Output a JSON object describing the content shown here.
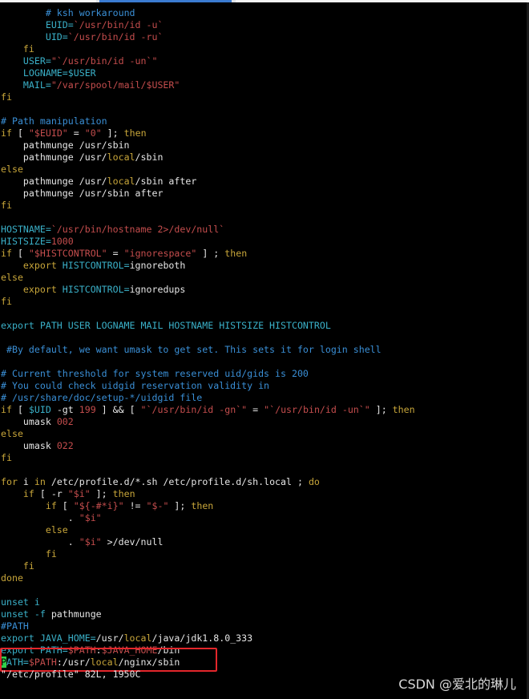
{
  "status_line": "\"/etc/profile\" 82L, 1950C",
  "watermark": "CSDN @爱北的琳儿",
  "lines": [
    [
      {
        "t": "        ",
        "c": "t"
      },
      {
        "t": "# ksh workaround",
        "c": "c"
      }
    ],
    [
      {
        "t": "        ",
        "c": "t"
      },
      {
        "t": "EUID=",
        "c": "v"
      },
      {
        "t": "`/usr/bin/id -u`",
        "c": "s"
      }
    ],
    [
      {
        "t": "        ",
        "c": "t"
      },
      {
        "t": "UID=",
        "c": "v"
      },
      {
        "t": "`/usr/bin/id -ru`",
        "c": "s"
      }
    ],
    [
      {
        "t": "    ",
        "c": "t"
      },
      {
        "t": "fi",
        "c": "k"
      }
    ],
    [
      {
        "t": "    ",
        "c": "t"
      },
      {
        "t": "USER=",
        "c": "v"
      },
      {
        "t": "\"`/usr/bin/id -un`\"",
        "c": "s"
      }
    ],
    [
      {
        "t": "    ",
        "c": "t"
      },
      {
        "t": "LOGNAME=",
        "c": "v"
      },
      {
        "t": "$USER",
        "c": "v"
      }
    ],
    [
      {
        "t": "    ",
        "c": "t"
      },
      {
        "t": "MAIL=",
        "c": "v"
      },
      {
        "t": "\"/var/spool/mail/$USER\"",
        "c": "s"
      }
    ],
    [
      {
        "t": "fi",
        "c": "k"
      }
    ],
    [],
    [
      {
        "t": "# Path manipulation",
        "c": "c"
      }
    ],
    [
      {
        "t": "if",
        "c": "k"
      },
      {
        "t": " [ ",
        "c": "t"
      },
      {
        "t": "\"$EUID\"",
        "c": "s"
      },
      {
        "t": " = ",
        "c": "t"
      },
      {
        "t": "\"0\"",
        "c": "s"
      },
      {
        "t": " ]; ",
        "c": "t"
      },
      {
        "t": "then",
        "c": "k"
      }
    ],
    [
      {
        "t": "    pathmunge /usr/sbin",
        "c": "t"
      }
    ],
    [
      {
        "t": "    pathmunge /usr/",
        "c": "t"
      },
      {
        "t": "local",
        "c": "k"
      },
      {
        "t": "/sbin",
        "c": "t"
      }
    ],
    [
      {
        "t": "else",
        "c": "k"
      }
    ],
    [
      {
        "t": "    pathmunge /usr/",
        "c": "t"
      },
      {
        "t": "local",
        "c": "k"
      },
      {
        "t": "/sbin after",
        "c": "t"
      }
    ],
    [
      {
        "t": "    pathmunge /usr/sbin after",
        "c": "t"
      }
    ],
    [
      {
        "t": "fi",
        "c": "k"
      }
    ],
    [],
    [
      {
        "t": "HOSTNAME=",
        "c": "v"
      },
      {
        "t": "`/usr/bin/hostname 2>/dev/null`",
        "c": "s"
      }
    ],
    [
      {
        "t": "HISTSIZE=",
        "c": "v"
      },
      {
        "t": "1000",
        "c": "s"
      }
    ],
    [
      {
        "t": "if",
        "c": "k"
      },
      {
        "t": " [ ",
        "c": "t"
      },
      {
        "t": "\"$HISTCONTROL\"",
        "c": "s"
      },
      {
        "t": " = ",
        "c": "t"
      },
      {
        "t": "\"ignorespace\"",
        "c": "s"
      },
      {
        "t": " ] ; ",
        "c": "t"
      },
      {
        "t": "then",
        "c": "k"
      }
    ],
    [
      {
        "t": "    ",
        "c": "t"
      },
      {
        "t": "export",
        "c": "k"
      },
      {
        "t": " HISTCONTROL=",
        "c": "v"
      },
      {
        "t": "ignoreboth",
        "c": "t"
      }
    ],
    [
      {
        "t": "else",
        "c": "k"
      }
    ],
    [
      {
        "t": "    ",
        "c": "t"
      },
      {
        "t": "export",
        "c": "k"
      },
      {
        "t": " HISTCONTROL=",
        "c": "v"
      },
      {
        "t": "ignoredups",
        "c": "t"
      }
    ],
    [
      {
        "t": "fi",
        "c": "k"
      }
    ],
    [],
    [
      {
        "t": "export PATH USER LOGNAME MAIL HOSTNAME HISTSIZE HISTCONTROL",
        "c": "v"
      }
    ],
    [],
    [
      {
        "t": " #By default, we want umask to get set. This sets it for login shell",
        "c": "c"
      }
    ],
    [],
    [
      {
        "t": "# Current threshold for system reserved uid/gids is 200",
        "c": "c"
      }
    ],
    [
      {
        "t": "# You could check uidgid reservation validity in",
        "c": "c"
      }
    ],
    [
      {
        "t": "# /usr/share/doc/setup-*/uidgid file",
        "c": "c"
      }
    ],
    [
      {
        "t": "if",
        "c": "k"
      },
      {
        "t": " [ ",
        "c": "t"
      },
      {
        "t": "$UID",
        "c": "v"
      },
      {
        "t": " -gt ",
        "c": "t"
      },
      {
        "t": "199",
        "c": "s"
      },
      {
        "t": " ] && [ ",
        "c": "t"
      },
      {
        "t": "\"`/usr/bin/id -gn`\"",
        "c": "s"
      },
      {
        "t": " = ",
        "c": "t"
      },
      {
        "t": "\"`/usr/bin/id -un`\"",
        "c": "s"
      },
      {
        "t": " ]; ",
        "c": "t"
      },
      {
        "t": "then",
        "c": "k"
      }
    ],
    [
      {
        "t": "    umask ",
        "c": "t"
      },
      {
        "t": "002",
        "c": "s"
      }
    ],
    [
      {
        "t": "else",
        "c": "k"
      }
    ],
    [
      {
        "t": "    umask ",
        "c": "t"
      },
      {
        "t": "022",
        "c": "s"
      }
    ],
    [
      {
        "t": "fi",
        "c": "k"
      }
    ],
    [],
    [
      {
        "t": "for",
        "c": "k"
      },
      {
        "t": " i ",
        "c": "t"
      },
      {
        "t": "in",
        "c": "k"
      },
      {
        "t": " /etc/profile.d/*.sh /etc/profile.d/sh.local ; ",
        "c": "t"
      },
      {
        "t": "do",
        "c": "k"
      }
    ],
    [
      {
        "t": "    ",
        "c": "t"
      },
      {
        "t": "if",
        "c": "k"
      },
      {
        "t": " [ -r ",
        "c": "t"
      },
      {
        "t": "\"$i\"",
        "c": "s"
      },
      {
        "t": " ]; ",
        "c": "t"
      },
      {
        "t": "then",
        "c": "k"
      }
    ],
    [
      {
        "t": "        ",
        "c": "t"
      },
      {
        "t": "if",
        "c": "k"
      },
      {
        "t": " [ ",
        "c": "t"
      },
      {
        "t": "\"${-#*i}\"",
        "c": "s"
      },
      {
        "t": " != ",
        "c": "t"
      },
      {
        "t": "\"$-\"",
        "c": "s"
      },
      {
        "t": " ]; ",
        "c": "t"
      },
      {
        "t": "then",
        "c": "k"
      }
    ],
    [
      {
        "t": "            . ",
        "c": "t"
      },
      {
        "t": "\"$i\"",
        "c": "s"
      }
    ],
    [
      {
        "t": "        ",
        "c": "t"
      },
      {
        "t": "else",
        "c": "k"
      }
    ],
    [
      {
        "t": "            . ",
        "c": "t"
      },
      {
        "t": "\"$i\"",
        "c": "s"
      },
      {
        "t": " >/dev/null",
        "c": "t"
      }
    ],
    [
      {
        "t": "        ",
        "c": "t"
      },
      {
        "t": "fi",
        "c": "k"
      }
    ],
    [
      {
        "t": "    ",
        "c": "t"
      },
      {
        "t": "fi",
        "c": "k"
      }
    ],
    [
      {
        "t": "done",
        "c": "k"
      }
    ],
    [],
    [
      {
        "t": "unset i",
        "c": "v"
      }
    ],
    [
      {
        "t": "unset -f ",
        "c": "v"
      },
      {
        "t": "pathmunge",
        "c": "t"
      }
    ],
    [
      {
        "t": "#PATH",
        "c": "c"
      }
    ],
    [
      {
        "t": "export JAVA_HOME=",
        "c": "v"
      },
      {
        "t": "/usr/",
        "c": "t"
      },
      {
        "t": "local",
        "c": "k"
      },
      {
        "t": "/java/jdk1.8.0_333",
        "c": "t"
      }
    ],
    [
      {
        "t": "export PATH=",
        "c": "v"
      },
      {
        "t": "$PATH",
        "c": "s"
      },
      {
        "t": ":",
        "c": "t"
      },
      {
        "t": "$JAVA_HOME",
        "c": "s"
      },
      {
        "t": "/bin",
        "c": "t"
      }
    ],
    [
      {
        "t": "P",
        "c": "cursor"
      },
      {
        "t": "ATH=",
        "c": "v"
      },
      {
        "t": "$PATH",
        "c": "s"
      },
      {
        "t": ":/usr/",
        "c": "t"
      },
      {
        "t": "local",
        "c": "k"
      },
      {
        "t": "/nginx/sbin",
        "c": "t"
      }
    ]
  ]
}
